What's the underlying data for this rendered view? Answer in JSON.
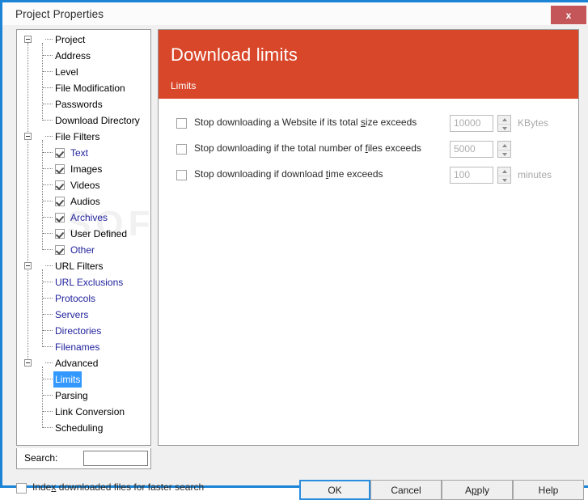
{
  "window": {
    "title": "Project Properties",
    "close_label": "x",
    "accent_border": "#1b84d6",
    "close_bg": "#c4565a"
  },
  "watermark": "SOFTPEDIA",
  "tree": {
    "nodes": [
      {
        "label": "Project",
        "level": 0,
        "type": "expander",
        "color": "black",
        "selected": false
      },
      {
        "label": "Address",
        "level": 1,
        "type": "leaf",
        "color": "black",
        "selected": false
      },
      {
        "label": "Level",
        "level": 1,
        "type": "leaf",
        "color": "black",
        "selected": false
      },
      {
        "label": "File Modification",
        "level": 1,
        "type": "leaf",
        "color": "black",
        "selected": false
      },
      {
        "label": "Passwords",
        "level": 1,
        "type": "leaf",
        "color": "black",
        "selected": false
      },
      {
        "label": "Download Directory",
        "level": 1,
        "type": "leaf",
        "color": "black",
        "selected": false
      },
      {
        "label": "File Filters",
        "level": 0,
        "type": "expander",
        "color": "black",
        "selected": false
      },
      {
        "label": "Text",
        "level": 1,
        "type": "checkbox",
        "color": "blue",
        "selected": false,
        "checked": true
      },
      {
        "label": "Images",
        "level": 1,
        "type": "checkbox",
        "color": "black",
        "selected": false,
        "checked": true
      },
      {
        "label": "Videos",
        "level": 1,
        "type": "checkbox",
        "color": "black",
        "selected": false,
        "checked": true
      },
      {
        "label": "Audios",
        "level": 1,
        "type": "checkbox",
        "color": "black",
        "selected": false,
        "checked": true
      },
      {
        "label": "Archives",
        "level": 1,
        "type": "checkbox",
        "color": "blue",
        "selected": false,
        "checked": true
      },
      {
        "label": "User Defined",
        "level": 1,
        "type": "checkbox",
        "color": "black",
        "selected": false,
        "checked": true
      },
      {
        "label": "Other",
        "level": 1,
        "type": "checkbox",
        "color": "blue",
        "selected": false,
        "checked": true
      },
      {
        "label": "URL Filters",
        "level": 0,
        "type": "expander",
        "color": "black",
        "selected": false
      },
      {
        "label": "URL Exclusions",
        "level": 1,
        "type": "leaf",
        "color": "blue",
        "selected": false
      },
      {
        "label": "Protocols",
        "level": 1,
        "type": "leaf",
        "color": "blue",
        "selected": false
      },
      {
        "label": "Servers",
        "level": 1,
        "type": "leaf",
        "color": "blue",
        "selected": false
      },
      {
        "label": "Directories",
        "level": 1,
        "type": "leaf",
        "color": "blue",
        "selected": false
      },
      {
        "label": "Filenames",
        "level": 1,
        "type": "leaf",
        "color": "blue",
        "selected": false
      },
      {
        "label": "Advanced",
        "level": 0,
        "type": "expander",
        "color": "black",
        "selected": false
      },
      {
        "label": "Limits",
        "level": 1,
        "type": "leaf",
        "color": "black",
        "selected": true
      },
      {
        "label": "Parsing",
        "level": 1,
        "type": "leaf",
        "color": "black",
        "selected": false
      },
      {
        "label": "Link Conversion",
        "level": 1,
        "type": "leaf",
        "color": "black",
        "selected": false
      },
      {
        "label": "Scheduling",
        "level": 1,
        "type": "leaf",
        "color": "black",
        "selected": false
      }
    ]
  },
  "search": {
    "label": "Search:",
    "value": "",
    "placeholder": ""
  },
  "main": {
    "header_title": "Download limits",
    "header_subtitle": "Limits",
    "header_bg": "#d9472a",
    "options": [
      {
        "label_pre": "Stop downloading a Website if its total ",
        "accel": "s",
        "label_post": "ize exceeds",
        "checked": false,
        "value": "10000",
        "unit": "KBytes",
        "enabled": false
      },
      {
        "label_pre": "Stop downloading if the total number of ",
        "accel": "f",
        "label_post": "iles exceeds",
        "checked": false,
        "value": "5000",
        "unit": "",
        "enabled": false
      },
      {
        "label_pre": "Stop downloading if download ",
        "accel": "t",
        "label_post": "ime exceeds",
        "checked": false,
        "value": "100",
        "unit": "minutes",
        "enabled": false
      }
    ]
  },
  "footer": {
    "index_checkbox": {
      "label_pre": "Inde",
      "accel": "x",
      "label_post": " downloaded files for faster search",
      "checked": false
    },
    "buttons": [
      {
        "label_pre": "OK",
        "accel": "",
        "label_post": "",
        "default": true
      },
      {
        "label_pre": "Cancel",
        "accel": "",
        "label_post": "",
        "default": false
      },
      {
        "label_pre": "A",
        "accel": "p",
        "label_post": "ply",
        "default": false
      },
      {
        "label_pre": "Help",
        "accel": "",
        "label_post": "",
        "default": false
      }
    ]
  }
}
